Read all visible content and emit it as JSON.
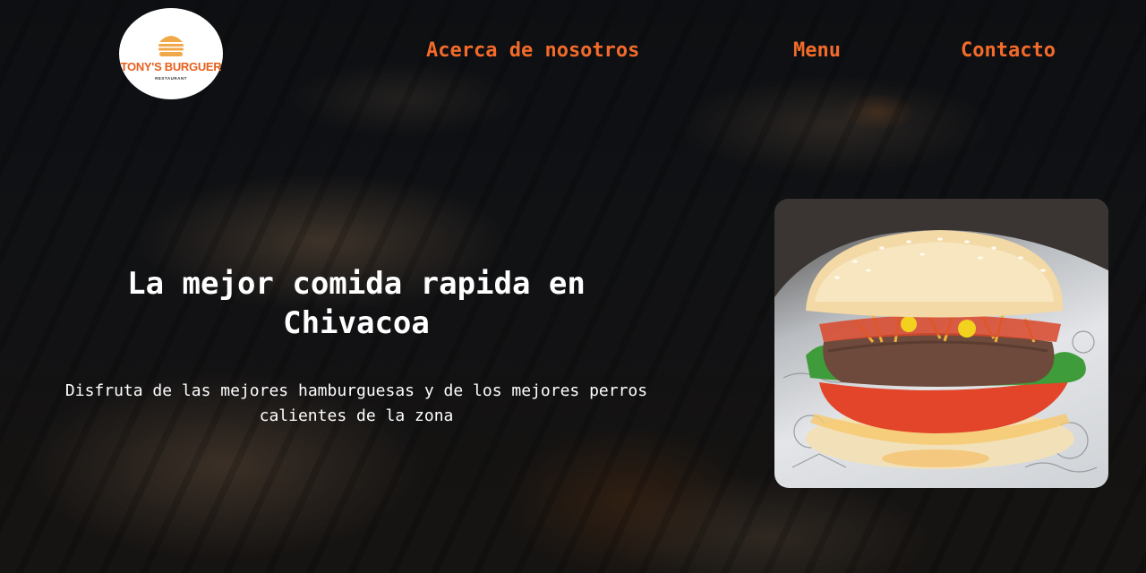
{
  "brand": {
    "name": "TONY'S BURGUER",
    "subtitle": "RESTAURANT",
    "accent_color": "#f26b2a",
    "logo_icon": "burger-icon"
  },
  "nav": {
    "items": [
      {
        "label": "Acerca de nosotros"
      },
      {
        "label": "Menu"
      },
      {
        "label": "Contacto"
      }
    ]
  },
  "hero": {
    "title": "La mejor comida rapida en Chivacoa",
    "subtitle": "Disfruta de las mejores hamburguesas y de los mejores perros calientes de la zona",
    "image": "burger-photo"
  }
}
